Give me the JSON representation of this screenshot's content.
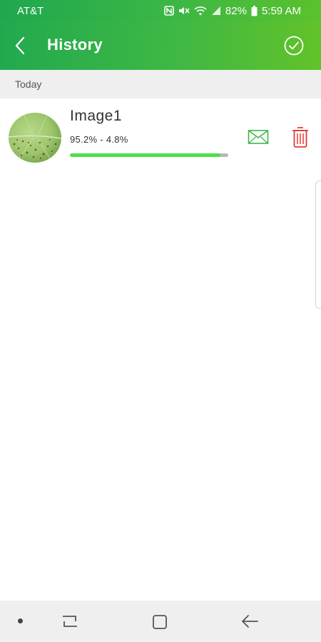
{
  "status_bar": {
    "carrier": "AT&T",
    "battery": "82%",
    "time": "5:59 AM",
    "icons": [
      "nfc-icon",
      "mute-icon",
      "wifi-icon",
      "signal-icon",
      "battery-icon"
    ]
  },
  "app_bar": {
    "title": "History",
    "back_icon": "chevron-left-icon",
    "confirm_icon": "check-circle-icon",
    "color_start": "#1fa84e",
    "color_end": "#62c229"
  },
  "section": {
    "label": "Today"
  },
  "items": [
    {
      "title": "Image1",
      "values": "95.2% - 4.8%",
      "progress": 0.952,
      "progress_color": "#4ee04a",
      "mail_icon": "mail-icon",
      "delete_icon": "trash-icon",
      "mail_color": "#3cb54a",
      "delete_color": "#e53935"
    }
  ],
  "nav_bar": {
    "icons": [
      "dot-icon",
      "recents-icon",
      "home-icon",
      "back-arrow-icon"
    ]
  }
}
